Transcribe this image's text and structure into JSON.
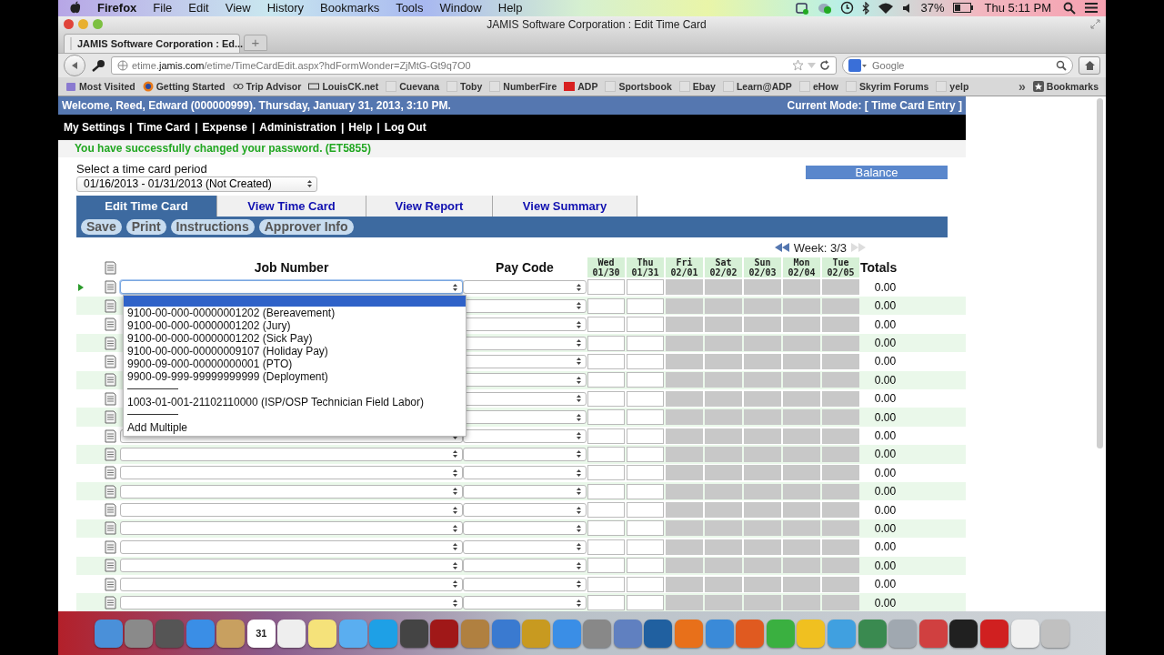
{
  "menubar": {
    "app": "Firefox",
    "menus": [
      "File",
      "Edit",
      "View",
      "History",
      "Bookmarks",
      "Tools",
      "Window",
      "Help"
    ],
    "battery": "37%",
    "clock": "Thu 5:11 PM"
  },
  "window": {
    "title": "JAMIS Software Corporation : Edit Time Card"
  },
  "browser_tabs": [
    {
      "label": "JAMIS Software Corporation : Ed...",
      "selected": true
    }
  ],
  "new_tab": "+",
  "address": {
    "url": "etime.**jamis.com**/etime/TimeCardEdit.aspx?hdFormWonder=ZjMtG-Gt9q7O0"
  },
  "search": {
    "placeholder": "Google"
  },
  "bookmarks": {
    "items": [
      {
        "label": "Most Visited",
        "kind": "folder"
      },
      {
        "label": "Getting Started",
        "kind": "globe"
      },
      {
        "label": "Trip Advisor",
        "kind": "owl"
      },
      {
        "label": "LouisCK.net",
        "kind": "badge"
      },
      {
        "label": "Cuevana",
        "kind": "blank"
      },
      {
        "label": "Toby",
        "kind": "blank"
      },
      {
        "label": "NumberFire",
        "kind": "blank"
      },
      {
        "label": "ADP",
        "kind": "red"
      },
      {
        "label": "Sportsbook",
        "kind": "blank"
      },
      {
        "label": "Ebay",
        "kind": "blank"
      },
      {
        "label": "Learn@ADP",
        "kind": "blank"
      },
      {
        "label": "eHow",
        "kind": "blank"
      },
      {
        "label": "Skyrim Forums",
        "kind": "blank"
      },
      {
        "label": "yelp",
        "kind": "blank"
      }
    ],
    "overflow": "»",
    "menu": "Bookmarks"
  },
  "page": {
    "welcome": "Welcome, Reed, Edward (000000999). Thursday, January 31, 2013, 3:10 PM.",
    "mode": "Current Mode: [ Time Card Entry ]",
    "nav": {
      "items": [
        "My Settings",
        "Time Card",
        "Expense",
        "Administration",
        "Help",
        "Log Out"
      ],
      "separator": "|"
    },
    "message": "You have successfully changed your password. (ET5855)",
    "period": {
      "label": "Select a time card period",
      "value": "01/16/2013 - 01/31/2013 (Not Created)"
    },
    "balance": "Balance",
    "tabs": [
      {
        "label": "Edit Time Card",
        "selected": true
      },
      {
        "label": "View Time Card",
        "selected": false
      },
      {
        "label": "View Report",
        "selected": false
      },
      {
        "label": "View Summary",
        "selected": false
      }
    ],
    "actions": [
      "Save",
      "Print",
      "Instructions",
      "Approver Info"
    ],
    "week": {
      "label": "Week: 3/3",
      "prev_disabled": false,
      "next_disabled": true
    },
    "grid": {
      "job": "Job Number",
      "pay": "Pay Code",
      "totals": "Totals",
      "days": [
        {
          "day": "Wed",
          "date": "01/30",
          "disabled": false
        },
        {
          "day": "Thu",
          "date": "01/31",
          "disabled": false
        },
        {
          "day": "Fri",
          "date": "02/01",
          "disabled": true
        },
        {
          "day": "Sat",
          "date": "02/02",
          "disabled": true
        },
        {
          "day": "Sun",
          "date": "02/03",
          "disabled": true
        },
        {
          "day": "Mon",
          "date": "02/04",
          "disabled": true
        },
        {
          "day": "Tue",
          "date": "02/05",
          "disabled": true
        }
      ],
      "rows": [
        {
          "selected": true,
          "covered": false,
          "total": "0.00"
        },
        {
          "selected": false,
          "covered": true,
          "total": "0.00"
        },
        {
          "selected": false,
          "covered": true,
          "total": "0.00"
        },
        {
          "selected": false,
          "covered": true,
          "total": "0.00"
        },
        {
          "selected": false,
          "covered": true,
          "total": "0.00"
        },
        {
          "selected": false,
          "covered": true,
          "total": "0.00"
        },
        {
          "selected": false,
          "covered": true,
          "total": "0.00"
        },
        {
          "selected": false,
          "covered": true,
          "total": "0.00"
        },
        {
          "selected": false,
          "covered": false,
          "total": "0.00"
        },
        {
          "selected": false,
          "covered": false,
          "total": "0.00"
        },
        {
          "selected": false,
          "covered": false,
          "total": "0.00"
        },
        {
          "selected": false,
          "covered": false,
          "total": "0.00"
        },
        {
          "selected": false,
          "covered": false,
          "total": "0.00"
        },
        {
          "selected": false,
          "covered": false,
          "total": "0.00"
        },
        {
          "selected": false,
          "covered": false,
          "total": "0.00"
        },
        {
          "selected": false,
          "covered": false,
          "total": "0.00"
        },
        {
          "selected": false,
          "covered": false,
          "total": "0.00"
        },
        {
          "selected": false,
          "covered": false,
          "total": "0.00"
        }
      ]
    },
    "dropdown": {
      "options": [
        {
          "kind": "blank",
          "selected": true
        },
        {
          "kind": "option",
          "text": "9100-00-000-00000001202 (Bereavement)",
          "selected": false
        },
        {
          "kind": "option",
          "text": "9100-00-000-00000001202 (Jury)",
          "selected": false
        },
        {
          "kind": "option",
          "text": "9100-00-000-00000001202 (Sick Pay)",
          "selected": false
        },
        {
          "kind": "option",
          "text": "9100-00-000-00000009107 (Holiday Pay)",
          "selected": false
        },
        {
          "kind": "option",
          "text": "9900-09-000-00000000001 (PTO)",
          "selected": false
        },
        {
          "kind": "option",
          "text": "9900-09-999-99999999999 (Deployment)",
          "selected": false
        },
        {
          "kind": "separator"
        },
        {
          "kind": "option",
          "text": "1003-01-001-21102110000 (ISP/OSP Technician Field Labor)",
          "selected": false
        },
        {
          "kind": "separator"
        },
        {
          "kind": "option",
          "text": "Add Multiple",
          "selected": false
        }
      ]
    }
  },
  "dock": [
    {
      "color": "#4a90d9"
    },
    {
      "color": "#8a8a8a"
    },
    {
      "color": "#555555"
    },
    {
      "color": "#3a8ee6"
    },
    {
      "color": "#c8a060"
    },
    {
      "color": "#ffffff",
      "label": "31"
    },
    {
      "color": "#eeeeee"
    },
    {
      "color": "#f5e27a"
    },
    {
      "color": "#5aaef0"
    },
    {
      "color": "#1ea0e6"
    },
    {
      "color": "#444444"
    },
    {
      "color": "#a01818"
    },
    {
      "color": "#b08040"
    },
    {
      "color": "#3a7ad0"
    },
    {
      "color": "#c89a20"
    },
    {
      "color": "#3a8ee6"
    },
    {
      "color": "#888888"
    },
    {
      "color": "#6080c0"
    },
    {
      "color": "#2060a0"
    },
    {
      "color": "#e8701a"
    },
    {
      "color": "#3a8ad8"
    },
    {
      "color": "#e05a20"
    },
    {
      "color": "#3ab040"
    },
    {
      "color": "#f0c020"
    },
    {
      "color": "#40a0e0"
    },
    {
      "color": "#3a8a50"
    },
    {
      "color": "#a0a8b0"
    },
    {
      "color": "#d04040"
    },
    {
      "color": "#202020"
    },
    {
      "color": "#d02020"
    },
    {
      "color": "#f0f0f0"
    },
    {
      "color": "#c0c0c0"
    }
  ]
}
